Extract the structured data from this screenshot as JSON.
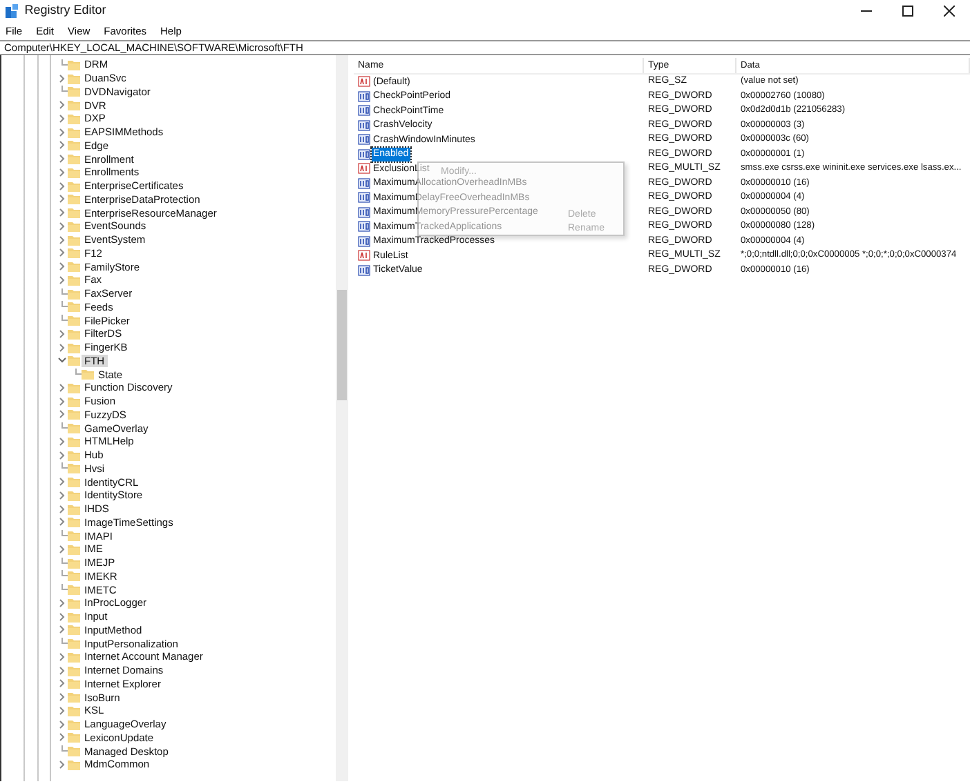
{
  "window": {
    "title": "Registry Editor"
  },
  "menu": [
    "File",
    "Edit",
    "View",
    "Favorites",
    "Help"
  ],
  "address": "Computer\\HKEY_LOCAL_MACHINE\\SOFTWARE\\Microsoft\\FTH",
  "tree": [
    {
      "label": "DRM",
      "selected": false
    },
    {
      "label": "DuanSvc",
      "expanded": false,
      "selected": false
    },
    {
      "label": "DVDNavigator",
      "selected": false
    },
    {
      "label": "DVR",
      "expanded": false,
      "selected": false
    },
    {
      "label": "DXP",
      "expanded": false,
      "selected": false
    },
    {
      "label": "EAPSIMMethods",
      "expanded": false,
      "selected": false
    },
    {
      "label": "Edge",
      "expanded": false,
      "selected": false
    },
    {
      "label": "Enrollment",
      "expanded": false,
      "selected": false
    },
    {
      "label": "Enrollments",
      "expanded": false,
      "selected": false
    },
    {
      "label": "EnterpriseCertificates",
      "expanded": false,
      "selected": false
    },
    {
      "label": "EnterpriseDataProtection",
      "expanded": false,
      "selected": false
    },
    {
      "label": "EnterpriseResourceManager",
      "expanded": false,
      "selected": false
    },
    {
      "label": "EventSounds",
      "expanded": false,
      "selected": false
    },
    {
      "label": "EventSystem",
      "expanded": false,
      "selected": false
    },
    {
      "label": "F12",
      "expanded": false,
      "selected": false
    },
    {
      "label": "FamilyStore",
      "expanded": false,
      "selected": false
    },
    {
      "label": "Fax",
      "expanded": false,
      "selected": false
    },
    {
      "label": "FaxServer",
      "selected": false
    },
    {
      "label": "Feeds",
      "selected": false
    },
    {
      "label": "FilePicker",
      "selected": false
    },
    {
      "label": "FilterDS",
      "expanded": false,
      "selected": false
    },
    {
      "label": "FingerKB",
      "expanded": false,
      "selected": false
    },
    {
      "label": "FTH",
      "expanded": true,
      "selected": true,
      "children": [
        {
          "label": "State",
          "selected": false
        }
      ]
    },
    {
      "label": "Function Discovery",
      "expanded": false,
      "selected": false
    },
    {
      "label": "Fusion",
      "expanded": false,
      "selected": false
    },
    {
      "label": "FuzzyDS",
      "expanded": false,
      "selected": false
    },
    {
      "label": "GameOverlay",
      "selected": false
    },
    {
      "label": "HTMLHelp",
      "expanded": false,
      "selected": false
    },
    {
      "label": "Hub",
      "expanded": false,
      "selected": false
    },
    {
      "label": "Hvsi",
      "selected": false
    },
    {
      "label": "IdentityCRL",
      "expanded": false,
      "selected": false
    },
    {
      "label": "IdentityStore",
      "expanded": false,
      "selected": false
    },
    {
      "label": "IHDS",
      "expanded": false,
      "selected": false
    },
    {
      "label": "ImageTimeSettings",
      "expanded": false,
      "selected": false
    },
    {
      "label": "IMAPI",
      "selected": false
    },
    {
      "label": "IME",
      "expanded": false,
      "selected": false
    },
    {
      "label": "IMEJP",
      "selected": false
    },
    {
      "label": "IMEKR",
      "selected": false
    },
    {
      "label": "IMETC",
      "selected": false
    },
    {
      "label": "InProcLogger",
      "expanded": false,
      "selected": false
    },
    {
      "label": "Input",
      "expanded": false,
      "selected": false
    },
    {
      "label": "InputMethod",
      "expanded": false,
      "selected": false
    },
    {
      "label": "InputPersonalization",
      "selected": false
    },
    {
      "label": "Internet Account Manager",
      "expanded": false,
      "selected": false
    },
    {
      "label": "Internet Domains",
      "expanded": false,
      "selected": false
    },
    {
      "label": "Internet Explorer",
      "expanded": false,
      "selected": false
    },
    {
      "label": "IsoBurn",
      "expanded": false,
      "selected": false
    },
    {
      "label": "KSL",
      "expanded": false,
      "selected": false
    },
    {
      "label": "LanguageOverlay",
      "expanded": false,
      "selected": false
    },
    {
      "label": "LexiconUpdate",
      "expanded": false,
      "selected": false
    },
    {
      "label": "Managed Desktop",
      "selected": false
    },
    {
      "label": "MdmCommon",
      "expanded": false,
      "selected": false
    }
  ],
  "values": {
    "columns": [
      "Name",
      "Type",
      "Data"
    ],
    "rows": [
      {
        "kind": "sz",
        "name": "(Default)",
        "type": "REG_SZ",
        "data": "(value not set)",
        "selected": false
      },
      {
        "kind": "dword",
        "name": "CheckPointPeriod",
        "type": "REG_DWORD",
        "data": "0x00002760 (10080)",
        "selected": false
      },
      {
        "kind": "dword",
        "name": "CheckPointTime",
        "type": "REG_DWORD",
        "data": "0x0d2d0d1b (221056283)",
        "selected": false
      },
      {
        "kind": "dword",
        "name": "CrashVelocity",
        "type": "REG_DWORD",
        "data": "0x00000003 (3)",
        "selected": false
      },
      {
        "kind": "dword",
        "name": "CrashWindowInMinutes",
        "type": "REG_DWORD",
        "data": "0x0000003c (60)",
        "selected": false
      },
      {
        "kind": "dword",
        "name": "Enabled",
        "type": "REG_DWORD",
        "data": "0x00000001 (1)",
        "selected": true
      },
      {
        "kind": "sz",
        "name": "ExclusionList",
        "type": "REG_MULTI_SZ",
        "data": "smss.exe csrss.exe wininit.exe services.exe lsass.ex...",
        "selected": false
      },
      {
        "kind": "dword",
        "name": "MaximumAllocationOverheadInMBs",
        "type": "REG_DWORD",
        "data": "0x00000010 (16)",
        "selected": false
      },
      {
        "kind": "dword",
        "name": "MaximumDelayFreeOverheadInMBs",
        "type": "REG_DWORD",
        "data": "0x00000004 (4)",
        "selected": false
      },
      {
        "kind": "dword",
        "name": "MaximumMemoryPressurePercentage",
        "type": "REG_DWORD",
        "data": "0x00000050 (80)",
        "selected": false
      },
      {
        "kind": "dword",
        "name": "MaximumTrackedApplications",
        "type": "REG_DWORD",
        "data": "0x00000080 (128)",
        "selected": false
      },
      {
        "kind": "dword",
        "name": "MaximumTrackedProcesses",
        "type": "REG_DWORD",
        "data": "0x00000004 (4)",
        "selected": false
      },
      {
        "kind": "sz",
        "name": "RuleList",
        "type": "REG_MULTI_SZ",
        "data": "*;0;0;ntdll.dll;0;0;0xC0000005 *;0;0;*;0;0;0xC0000374",
        "selected": false
      },
      {
        "kind": "dword",
        "name": "TicketValue",
        "type": "REG_DWORD",
        "data": "0x00000010 (16)",
        "selected": false
      }
    ]
  },
  "context_menu": [
    "Modify...",
    "Delete",
    "Rename"
  ]
}
